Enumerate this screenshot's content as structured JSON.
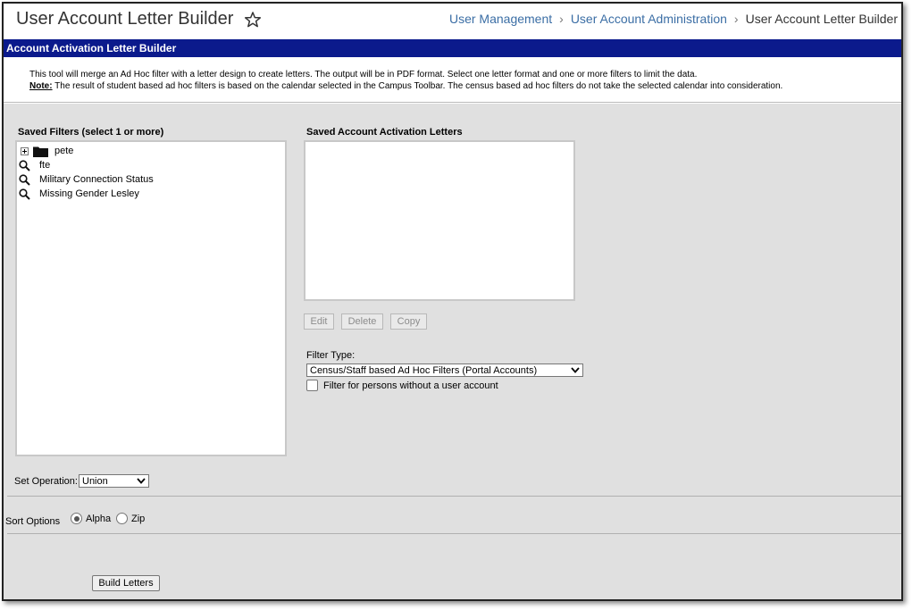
{
  "header": {
    "title": "User Account Letter Builder",
    "breadcrumb": [
      "User Management",
      "User Account Administration",
      "User Account Letter Builder"
    ]
  },
  "banner": {
    "title": "Account Activation Letter Builder"
  },
  "intro": {
    "line1": "This tool will merge an Ad Hoc filter with a letter design to create letters. The output will be in PDF format. Select one letter format and one or more filters to limit the data.",
    "note_label": "Note:",
    "line2": " The result of student based ad hoc filters is based on the calendar selected in the Campus Toolbar. The census based ad hoc filters do not take the selected calendar into consideration."
  },
  "saved_filters": {
    "label": "Saved Filters (select 1 or more)",
    "folder": "pete",
    "items": [
      "fte",
      "Military Connection Status",
      "Missing Gender Lesley"
    ]
  },
  "letters": {
    "label": "Saved Account Activation Letters",
    "buttons": {
      "edit": "Edit",
      "delete": "Delete",
      "copy": "Copy"
    }
  },
  "filter_type": {
    "label": "Filter Type:",
    "selected": "Census/Staff based Ad Hoc Filters (Portal Accounts)",
    "checkbox_label": "Filter for persons without a user account",
    "checked": false
  },
  "set_operation": {
    "label": "Set Operation:",
    "selected": "Union"
  },
  "sort_options": {
    "label": "Sort Options",
    "options": [
      "Alpha",
      "Zip"
    ],
    "selected": "Alpha"
  },
  "actions": {
    "build": "Build Letters"
  },
  "colors": {
    "banner": "#0b1a8c",
    "link": "#3b6ea5",
    "panel_bg": "#e0e0e0"
  }
}
